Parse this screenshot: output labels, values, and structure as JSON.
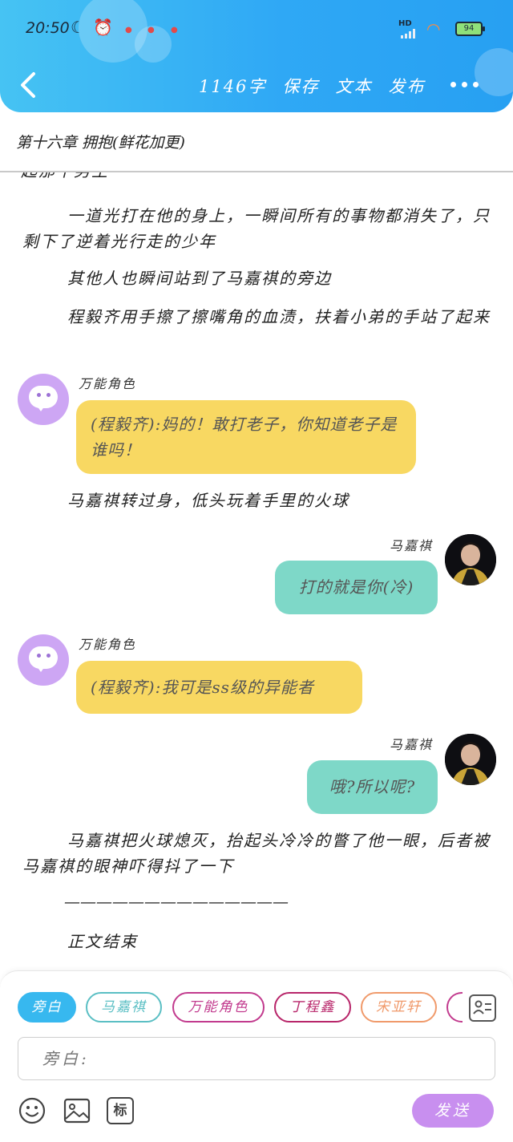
{
  "status_bar": {
    "time": "20:50",
    "battery": "94",
    "network": "HD"
  },
  "toolbar": {
    "word_count": "1146字",
    "save": "保存",
    "text": "文本",
    "publish": "发布"
  },
  "chapter_title": "第十六章 拥抱(鲜花加更)",
  "story": {
    "cutoff_line": "起那个男生",
    "p1": "一道光打在他的身上，一瞬间所有的事物都消失了，只剩下了逆着光行走的少年",
    "p2": "其他人也瞬间站到了马嘉祺的旁边",
    "p3": "程毅齐用手擦了擦嘴角的血渍，扶着小弟的手站了起来",
    "p4": "马嘉祺转过身，低头玩着手里的火球",
    "p5": "马嘉祺把火球熄灭，抬起头冷冷的瞥了他一眼，后者被马嘉祺的眼神吓得抖了一下",
    "separator": "——————————————",
    "p6": "正文结束"
  },
  "messages": [
    {
      "speaker": "万能角色",
      "text": "(程毅齐):妈的！敢打老子，你知道老子是谁吗！",
      "color": "#f8d862"
    },
    {
      "speaker": "马嘉祺",
      "text": "打的就是你(冷)",
      "color": "#7ed8c8"
    },
    {
      "speaker": "万能角色",
      "text": "(程毅齐):我可是ss级的异能者",
      "color": "#f8d862"
    },
    {
      "speaker": "马嘉祺",
      "text": "哦?所以呢?",
      "color": "#7ed8c8"
    }
  ],
  "roles": [
    {
      "label": "旁白",
      "color": "#37b8ef",
      "active": true
    },
    {
      "label": "马嘉祺",
      "color": "#5bbfc4",
      "active": false
    },
    {
      "label": "万能角色",
      "color": "#c23b8e",
      "active": false
    },
    {
      "label": "丁程鑫",
      "color": "#b8266a",
      "active": false
    },
    {
      "label": "宋亚轩",
      "color": "#f09a6b",
      "active": false
    }
  ],
  "input": {
    "value": "旁白:"
  },
  "send_label": "发送",
  "tools": {
    "emoji": "emoji-icon",
    "image": "image-icon",
    "mark": "标"
  }
}
